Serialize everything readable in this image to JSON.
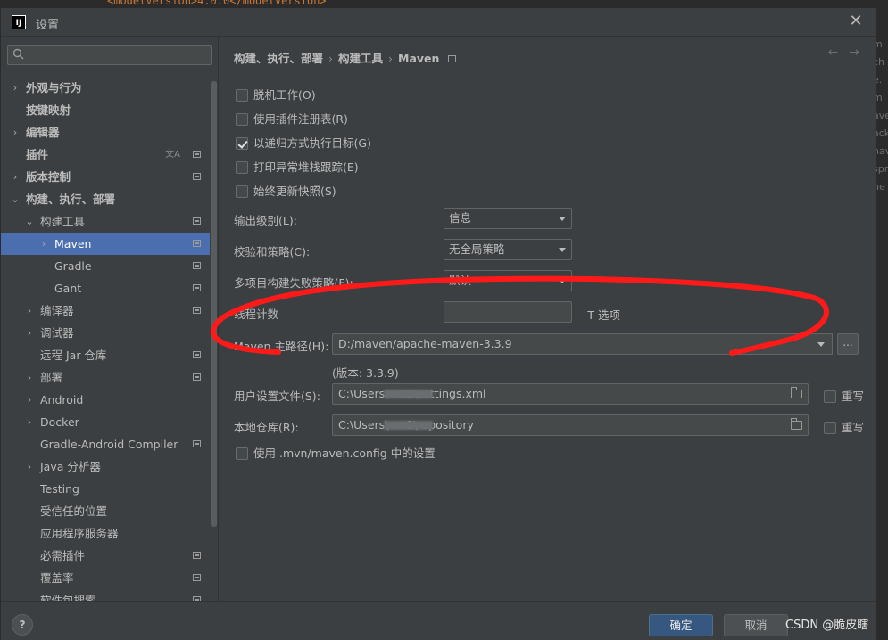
{
  "background": {
    "code_snippet": "<modelVersion>4.0.0</modelVersion>",
    "right_strip": [
      "m",
      "ch",
      "e.",
      "m",
      "ave",
      "ack",
      "nav",
      "spr",
      "he"
    ]
  },
  "dialog": {
    "title": "设置",
    "app_icon_text": "IJ",
    "close_glyph": "✕"
  },
  "sidebar": {
    "search_placeholder": "",
    "items": [
      {
        "label": "外观与行为",
        "indent": 0,
        "arrow": "›",
        "bold": true
      },
      {
        "label": "按键映射",
        "indent": 0,
        "arrow": "",
        "bold": true
      },
      {
        "label": "编辑器",
        "indent": 0,
        "arrow": "›",
        "bold": true
      },
      {
        "label": "插件",
        "indent": 0,
        "arrow": "",
        "bold": true,
        "translate_icon": true,
        "project_icon": true
      },
      {
        "label": "版本控制",
        "indent": 0,
        "arrow": "›",
        "bold": true,
        "project_icon": true
      },
      {
        "label": "构建、执行、部署",
        "indent": 0,
        "arrow": "⌄",
        "bold": true
      },
      {
        "label": "构建工具",
        "indent": 1,
        "arrow": "⌄",
        "project_icon": true
      },
      {
        "label": "Maven",
        "indent": 2,
        "arrow": "›",
        "selected": true,
        "project_icon": true
      },
      {
        "label": "Gradle",
        "indent": 2,
        "arrow": "",
        "project_icon": true
      },
      {
        "label": "Gant",
        "indent": 2,
        "arrow": "",
        "project_icon": true
      },
      {
        "label": "编译器",
        "indent": 1,
        "arrow": "›",
        "project_icon": true
      },
      {
        "label": "调试器",
        "indent": 1,
        "arrow": "›"
      },
      {
        "label": "远程 Jar 仓库",
        "indent": 1,
        "arrow": "",
        "project_icon": true
      },
      {
        "label": "部署",
        "indent": 1,
        "arrow": "›",
        "project_icon": true
      },
      {
        "label": "Android",
        "indent": 1,
        "arrow": "›"
      },
      {
        "label": "Docker",
        "indent": 1,
        "arrow": "›"
      },
      {
        "label": "Gradle-Android Compiler",
        "indent": 1,
        "arrow": "",
        "project_icon": true
      },
      {
        "label": "Java 分析器",
        "indent": 1,
        "arrow": "›"
      },
      {
        "label": "Testing",
        "indent": 1,
        "arrow": ""
      },
      {
        "label": "受信任的位置",
        "indent": 1,
        "arrow": ""
      },
      {
        "label": "应用程序服务器",
        "indent": 1,
        "arrow": ""
      },
      {
        "label": "必需插件",
        "indent": 1,
        "arrow": "",
        "project_icon": true
      },
      {
        "label": "覆盖率",
        "indent": 1,
        "arrow": "",
        "project_icon": true
      },
      {
        "label": "软件包搜索",
        "indent": 1,
        "arrow": "",
        "project_icon": true
      }
    ]
  },
  "main": {
    "breadcrumb": [
      "构建、执行、部署",
      "构建工具",
      "Maven"
    ],
    "breadcrumb_sep": "›",
    "nav_back": "←",
    "nav_forward": "→",
    "checkboxes": [
      {
        "label": "脱机工作(O)",
        "checked": false
      },
      {
        "label": "使用插件注册表(R)",
        "checked": false
      },
      {
        "label": "以递归方式执行目标(G)",
        "checked": true
      },
      {
        "label": "打印异常堆栈跟踪(E)",
        "checked": false
      },
      {
        "label": "始终更新快照(S)",
        "checked": false
      }
    ],
    "output_level_label": "输出级别(L):",
    "output_level_value": "信息",
    "checksum_label": "校验和策略(C):",
    "checksum_value": "无全局策略",
    "multiproject_label": "多项目构建失败策略(F):",
    "multiproject_value": "默认",
    "thread_label": "线程计数",
    "thread_value": "",
    "thread_hint": "-T 选项",
    "maven_home_label": "Maven 主路径(H):",
    "maven_home_value": "D:/maven/apache-maven-3.3.9",
    "browse_label": "...",
    "version_text": "(版本: 3.3.9)",
    "user_settings_label": "用户设置文件(S):",
    "user_settings_value": "C:\\Users\\          .m2\\settings.xml",
    "user_settings_override": "重写",
    "local_repo_label": "本地仓库(R):",
    "local_repo_value": "C:\\Users\\          .m2\\repository",
    "local_repo_override": "重写",
    "mvn_config_label": "使用 .mvn/maven.config 中的设置"
  },
  "footer": {
    "help_label": "?",
    "ok_label": "确定",
    "cancel_label": "取消",
    "watermark": "CSDN @脆皮瞎"
  },
  "colors": {
    "accent_selected": "#4b6eaf",
    "primary_button": "#365880",
    "annotation": "#ff1a1a"
  }
}
